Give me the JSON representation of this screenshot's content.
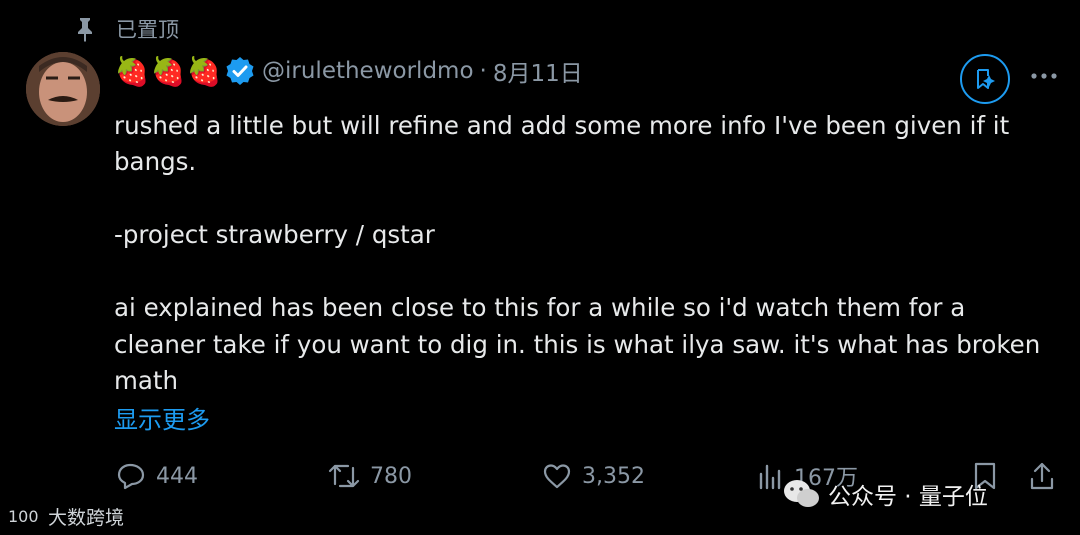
{
  "pinned": {
    "label": "已置顶",
    "icon": "pin-icon"
  },
  "tweet": {
    "emojis": [
      "🍓",
      "🍓",
      "🍓"
    ],
    "handle": "@iruletheworldmo",
    "separator": "·",
    "date": "8月11日",
    "lines": [
      "rushed a little but will refine and add some more info I've been given if it",
      "bangs.",
      "-project strawberry / qstar",
      "ai explained has been close to this for a while so i'd watch them for a",
      "cleaner take if you want to dig in. this is what ilya saw. it's what has broken",
      "math"
    ],
    "show_more": "显示更多"
  },
  "actions": {
    "replies": "444",
    "retweets": "780",
    "likes": "3,352",
    "views": "167万"
  },
  "watermarks": {
    "left_text": "大数跨境",
    "right_text": "公众号 · 量子位"
  },
  "colors": {
    "accent": "#1d9bf0",
    "muted": "#8b98a5",
    "text": "#e7e9ea",
    "background": "#000000"
  }
}
